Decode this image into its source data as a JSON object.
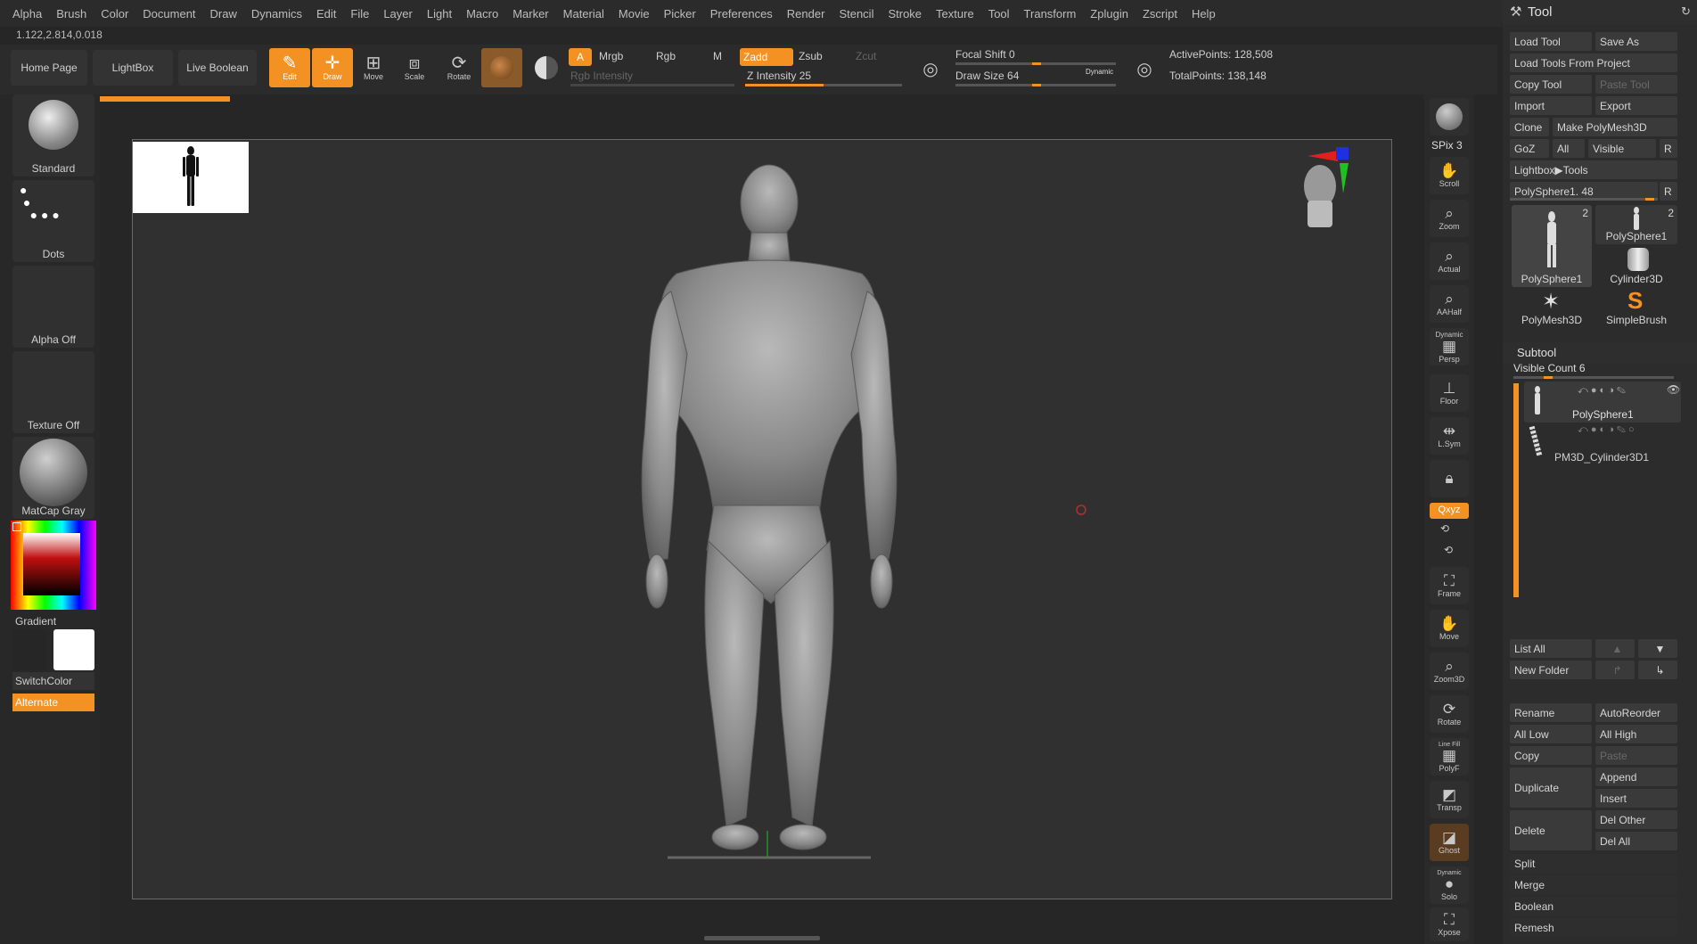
{
  "menu": [
    "Alpha",
    "Brush",
    "Color",
    "Document",
    "Draw",
    "Dynamics",
    "Edit",
    "File",
    "Layer",
    "Light",
    "Macro",
    "Marker",
    "Material",
    "Movie",
    "Picker",
    "Preferences",
    "Render",
    "Stencil",
    "Stroke",
    "Texture",
    "Tool",
    "Transform",
    "Zplugin",
    "Zscript",
    "Help"
  ],
  "coords": "1.122,2.814,0.018",
  "toolbar": {
    "home_page": "Home Page",
    "lightbox": "LightBox",
    "live_boolean": "Live Boolean",
    "edit": "Edit",
    "draw": "Draw",
    "move": "Move",
    "scale": "Scale",
    "rotate": "Rotate",
    "a": "A",
    "mrgb": "Mrgb",
    "rgb": "Rgb",
    "m": "M",
    "zadd": "Zadd",
    "zsub": "Zsub",
    "zcut": "Zcut",
    "rgb_intensity": "Rgb Intensity",
    "z_intensity": "Z Intensity 25",
    "z_intensity_value": 0.25,
    "focal_shift": "Focal Shift 0",
    "draw_size": "Draw Size 64",
    "dynamic": "Dynamic",
    "active_points": "ActivePoints: 128,508",
    "total_points": "TotalPoints: 138,148"
  },
  "left": {
    "brush": "Standard",
    "stroke": "Dots",
    "alpha": "Alpha Off",
    "texture": "Texture Off",
    "material": "MatCap Gray",
    "gradient": "Gradient",
    "switchcolor": "SwitchColor",
    "alternate": "Alternate"
  },
  "shelf": {
    "bpr": "BPR",
    "spix": "SPix 3",
    "scroll": "Scroll",
    "zoom": "Zoom",
    "actual": "Actual",
    "aahalf": "AAHalf",
    "persp": "Persp",
    "dynamic": "Dynamic",
    "floor": "Floor",
    "lsym": "L.Sym",
    "xyz": "Qxyz",
    "frame": "Frame",
    "move": "Move",
    "zoom3d": "Zoom3D",
    "rotate": "Rotate",
    "linefill": "Line Fill",
    "polyf": "PolyF",
    "transp": "Transp",
    "ghost": "Ghost",
    "solo": "Solo",
    "xpose": "Xpose"
  },
  "tool": {
    "title": "Tool",
    "load_tool": "Load Tool",
    "save_as": "Save As",
    "load_from_project": "Load Tools From Project",
    "copy_tool": "Copy Tool",
    "paste_tool": "Paste Tool",
    "import": "Import",
    "export": "Export",
    "clone": "Clone",
    "make_polymesh": "Make PolyMesh3D",
    "goz": "GoZ",
    "all": "All",
    "visible": "Visible",
    "r": "R",
    "lightbox_tools": "Lightbox▶Tools",
    "current_tool": "PolySphere1. 48",
    "thumbs": [
      {
        "label": "PolySphere1",
        "count": "2"
      },
      {
        "label": "PolySphere1",
        "count": "2"
      },
      {
        "label": "Cylinder3D",
        "count": ""
      },
      {
        "label": "PolyMesh3D",
        "count": ""
      },
      {
        "label": "SimpleBrush",
        "count": ""
      }
    ]
  },
  "subtool": {
    "title": "Subtool",
    "visible_count": "Visible Count 6",
    "items": [
      "PolySphere1",
      "PM3D_Cylinder3D1"
    ],
    "list_all": "List All",
    "new_folder": "New Folder",
    "rename": "Rename",
    "autoreorder": "AutoReorder",
    "all_low": "All Low",
    "all_high": "All High",
    "copy": "Copy",
    "paste": "Paste",
    "duplicate": "Duplicate",
    "append": "Append",
    "insert": "Insert",
    "delete": "Delete",
    "del_other": "Del Other",
    "del_all": "Del All",
    "split": "Split",
    "merge": "Merge",
    "boolean": "Boolean",
    "remesh": "Remesh"
  },
  "colors": {
    "accent": "#f39222",
    "canvas": "#303030",
    "panel": "#2c2c2c"
  }
}
